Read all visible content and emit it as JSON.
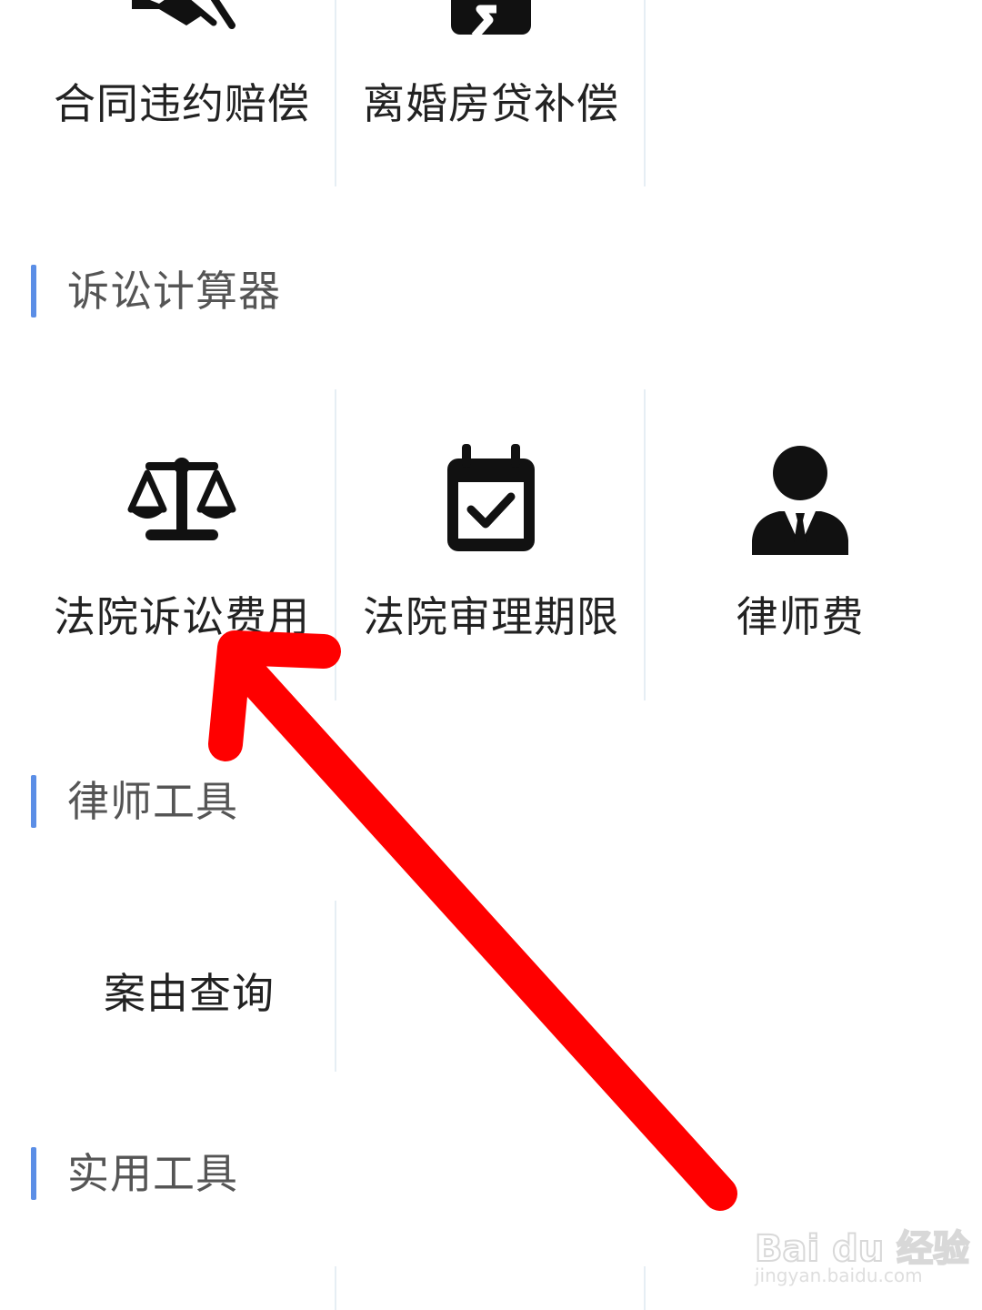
{
  "top_row": {
    "items": [
      {
        "label": "合同违约赔偿",
        "icon": "contract-breach-icon"
      },
      {
        "label": "离婚房贷补偿",
        "icon": "divorce-mortgage-icon"
      }
    ]
  },
  "sections": {
    "litigation": {
      "title": "诉讼计算器",
      "items": [
        {
          "label": "法院诉讼费用",
          "icon": "scales-icon"
        },
        {
          "label": "法院审理期限",
          "icon": "calendar-check-icon"
        },
        {
          "label": "律师费",
          "icon": "lawyer-icon"
        }
      ]
    },
    "lawyer_tools": {
      "title": "律师工具",
      "items": [
        {
          "label": "案由查询"
        }
      ]
    },
    "practical_tools": {
      "title": "实用工具"
    }
  },
  "colors": {
    "section_bar": "#5b8ee6",
    "annotation_arrow": "#ff0000",
    "divider": "#e6eef4"
  },
  "watermark": {
    "brand": "Bai du 经验",
    "url": "jingyan.baidu.com"
  }
}
